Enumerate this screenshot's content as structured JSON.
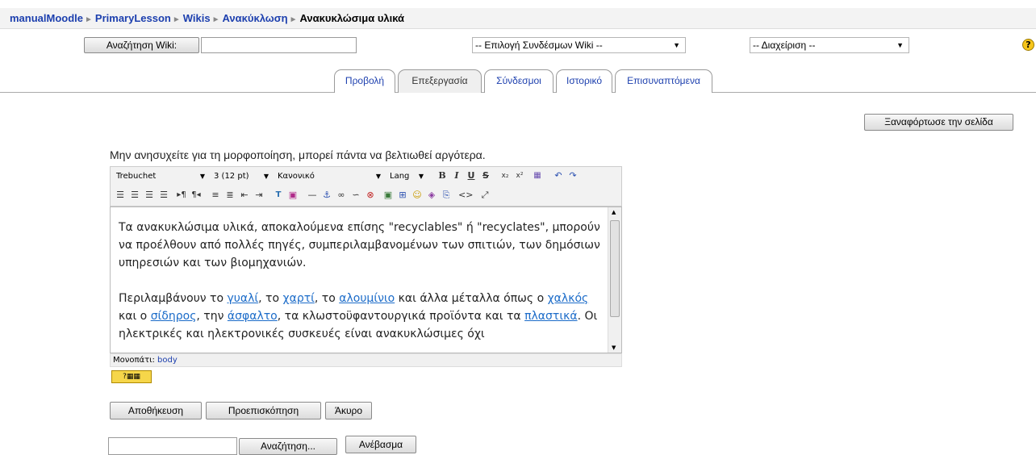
{
  "breadcrumb": {
    "items": [
      "manualMoodle",
      "PrimaryLesson",
      "Wikis",
      "Ανακύκλωση"
    ],
    "current": "Ανακυκλώσιμα υλικά",
    "separator": "►"
  },
  "search": {
    "button_label": "Αναζήτηση Wiki:",
    "value": ""
  },
  "links_select": {
    "selected": "-- Επιλογή Συνδέσμων Wiki --"
  },
  "admin_select": {
    "selected": "-- Διαχείριση --"
  },
  "help": {
    "symbol": "?"
  },
  "tabs": [
    {
      "label": "Προβολή",
      "active": false
    },
    {
      "label": "Επεξεργασία",
      "active": true
    },
    {
      "label": "Σύνδεσμοι",
      "active": false
    },
    {
      "label": "Ιστορικό",
      "active": false
    },
    {
      "label": "Επισυναπτόμενα",
      "active": false
    }
  ],
  "reload_button": "Ξαναφόρτωσε την σελίδα",
  "notice": "Μην ανησυχείτε για τη μορφοποίηση, μπορεί πάντα να βελτιωθεί αργότερα.",
  "toolbar": {
    "font": "Trebuchet",
    "size": "3 (12 pt)",
    "style": "Κανονικό",
    "lang": "Lang"
  },
  "editor": {
    "p1": "Τα ανακυκλώσιμα υλικά, αποκαλούμενα επίσης \"recyclables\" ή \"recyclates\", μπορούν να προέλθουν από πολλές πηγές, συμπεριλαμβανομένων των σπιτιών, των δημόσιων υπηρεσιών και των βιομηχανιών.",
    "p2_a": "Περιλαμβάνουν το ",
    "link_glass": "γυαλί",
    "p2_b": ", το ",
    "link_paper": "χαρτί",
    "p2_c": ", το ",
    "link_aluminium": "αλουμίνιο",
    "p2_d": " και άλλα μέταλλα όπως ο ",
    "link_copper": "χαλκός",
    "p2_e": " και ο ",
    "link_iron": "σίδηρος",
    "p2_f": ", την ",
    "link_asphalt": "άσφαλτο",
    "p2_g": ", τα κλωστοϋφαντουργικά προϊόντα και τα ",
    "link_plastic": "πλαστικά",
    "p2_h": ". Οι ηλεκτρικές και ηλεκτρονικές συσκευές είναι ανακυκλώσιμες όχι"
  },
  "path": {
    "label": "Μονοπάτι:",
    "value": "body"
  },
  "buttons": {
    "save": "Αποθήκευση",
    "preview": "Προεπισκόπηση",
    "cancel": "Άκυρο"
  },
  "upload": {
    "browse": "Αναζήτηση...",
    "upload": "Ανέβασμα"
  }
}
